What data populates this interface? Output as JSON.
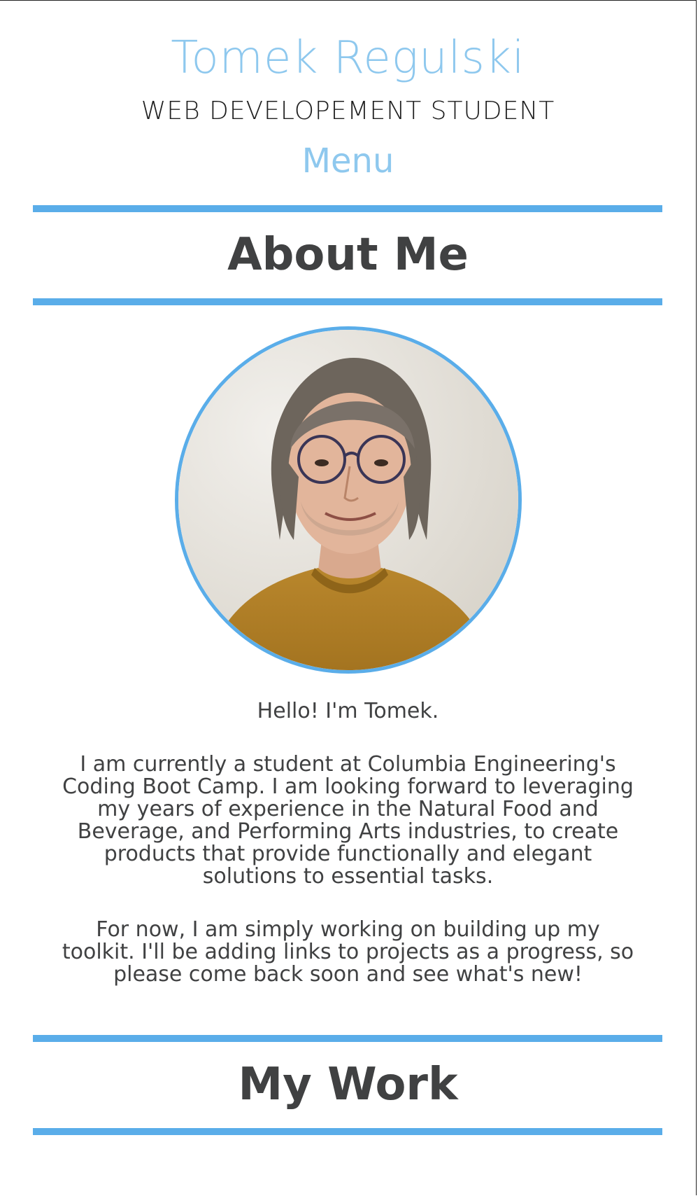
{
  "header": {
    "site_name": "Tomek Regulski",
    "subtitle": "WEB DEVELOPEMENT STUDENT",
    "menu_label": "Menu"
  },
  "about": {
    "heading": "About Me",
    "greeting": "Hello! I'm Tomek.",
    "bio": "I am currently a student at Columbia Engineering's Coding Boot Camp. I am looking forward to leveraging my years of experience in the Natural Food and Beverage, and Performing Arts industries, to create products that provide functionally and elegant solutions to essential tasks.",
    "closing": "For now, I am simply working on building up my toolkit. I'll be adding links to projects as a progress, so please come back soon and see what's new!"
  },
  "work": {
    "heading": "My Work"
  },
  "colors": {
    "accent": "#5aade9",
    "name_blue": "#8ec8ee",
    "heading_text": "#404142"
  }
}
